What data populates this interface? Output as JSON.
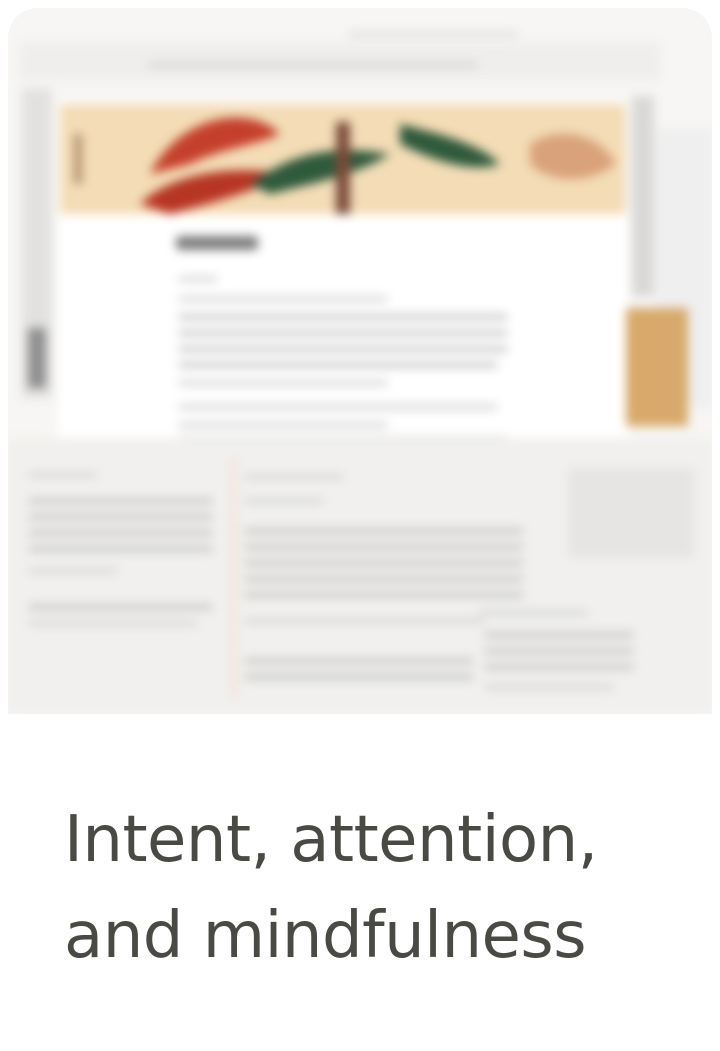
{
  "card": {
    "preview_image": "blurred-document-editor-screenshot",
    "caption_lines": [
      "Intent, attention,",
      "and mindfulness"
    ]
  },
  "colors": {
    "card_background": "#f7f6f4",
    "caption_text": "#4a4a44",
    "banner": "#f3dcb6",
    "banner_red": "#c5402c",
    "banner_green": "#2f5a3c"
  }
}
